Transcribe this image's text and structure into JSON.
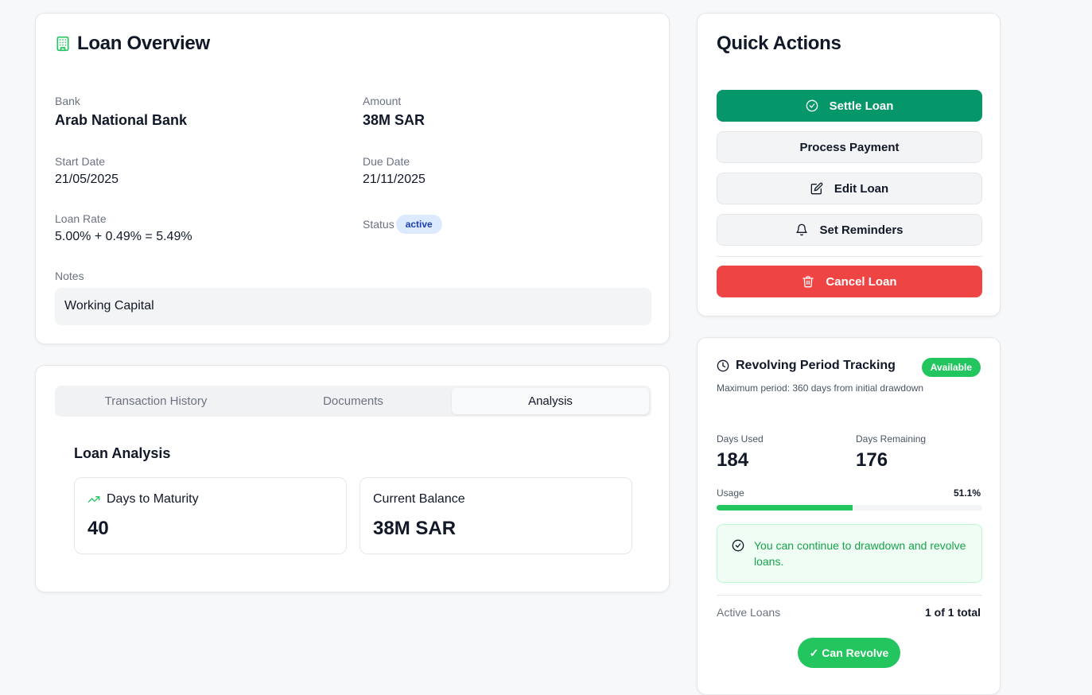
{
  "overview": {
    "title": "Loan Overview",
    "bank_label": "Bank",
    "bank_value": "Arab National Bank",
    "amount_label": "Amount",
    "amount_value": "38M SAR",
    "start_label": "Start Date",
    "start_value": "21/05/2025",
    "due_label": "Due Date",
    "due_value": "21/11/2025",
    "rate_label": "Loan Rate",
    "rate_value": "5.00% + 0.49% = 5.49%",
    "status_label": "Status",
    "status_value": "active",
    "notes_label": "Notes",
    "notes_value": "Working Capital",
    "icon": "building-icon"
  },
  "tabs": {
    "items": [
      "Transaction History",
      "Documents",
      "Analysis"
    ],
    "active": "Analysis"
  },
  "analysis": {
    "title": "Loan Analysis",
    "maturity_label": "Days to Maturity",
    "maturity_value": "40",
    "balance_label": "Current Balance",
    "balance_value": "38M SAR"
  },
  "actions": {
    "title": "Quick Actions",
    "settle": "Settle Loan",
    "payment": "Process Payment",
    "edit": "Edit Loan",
    "reminders": "Set Reminders",
    "cancel": "Cancel Loan"
  },
  "revolving": {
    "title": "Revolving Period Tracking",
    "badge": "Available",
    "subtitle": "Maximum period: 360 days from initial drawdown",
    "used_label": "Days Used",
    "used_value": "184",
    "remaining_label": "Days Remaining",
    "remaining_value": "176",
    "usage_label": "Usage",
    "usage_pct": "51.1%",
    "usage_fraction": 0.511,
    "info_text": "You can continue to drawdown and revolve loans.",
    "active_loans_label": "Active Loans",
    "active_loans_value": "1 of 1 total",
    "revolve_button": "✓ Can Revolve"
  },
  "colors": {
    "primary_green": "#059669",
    "accent_green": "#22c55e",
    "danger_red": "#ef4444",
    "status_blue": "#1e40af"
  }
}
